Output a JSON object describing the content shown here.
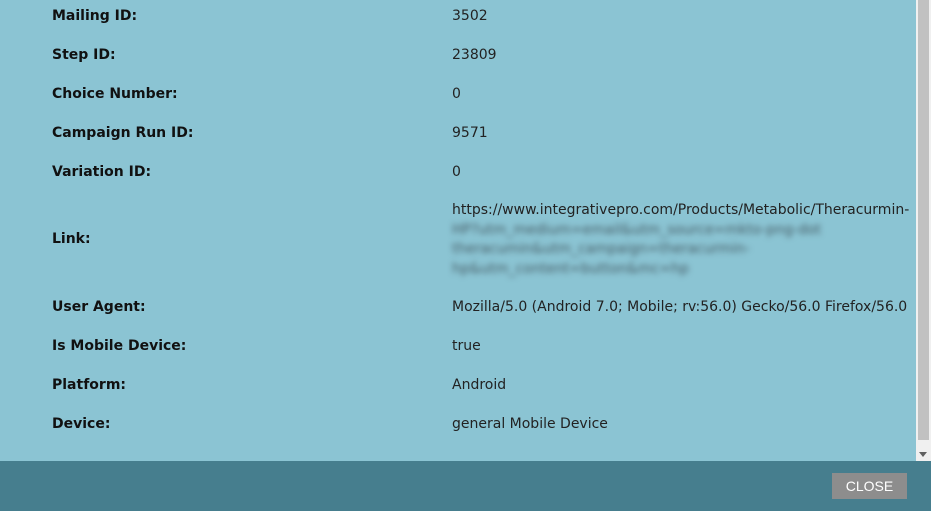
{
  "details": [
    {
      "label": "Mailing ID:",
      "value": "3502"
    },
    {
      "label": "Step ID:",
      "value": "23809"
    },
    {
      "label": "Choice Number:",
      "value": "0"
    },
    {
      "label": "Campaign Run ID:",
      "value": "9571"
    },
    {
      "label": "Variation ID:",
      "value": "0"
    },
    {
      "label": "Link:",
      "value_lines": [
        "https://www.integrativepro.com/Products/Metabolic/Theracurmin-",
        "HP?utm_medium=email&utm_source=mkto-png-dot",
        "theracumin&utm_campaign=theracurmin-",
        "hp&utm_content=button&mc=hp"
      ]
    },
    {
      "label": "User Agent:",
      "value": "Mozilla/5.0 (Android 7.0; Mobile; rv:56.0) Gecko/56.0 Firefox/56.0"
    },
    {
      "label": "Is Mobile Device:",
      "value": "true"
    },
    {
      "label": "Platform:",
      "value": "Android"
    },
    {
      "label": "Device:",
      "value": "general Mobile Device"
    }
  ],
  "footer": {
    "close_label": "CLOSE"
  },
  "colors": {
    "background": "#8bc4d3",
    "footer": "#467e8e",
    "button": "#8d8d8d"
  }
}
